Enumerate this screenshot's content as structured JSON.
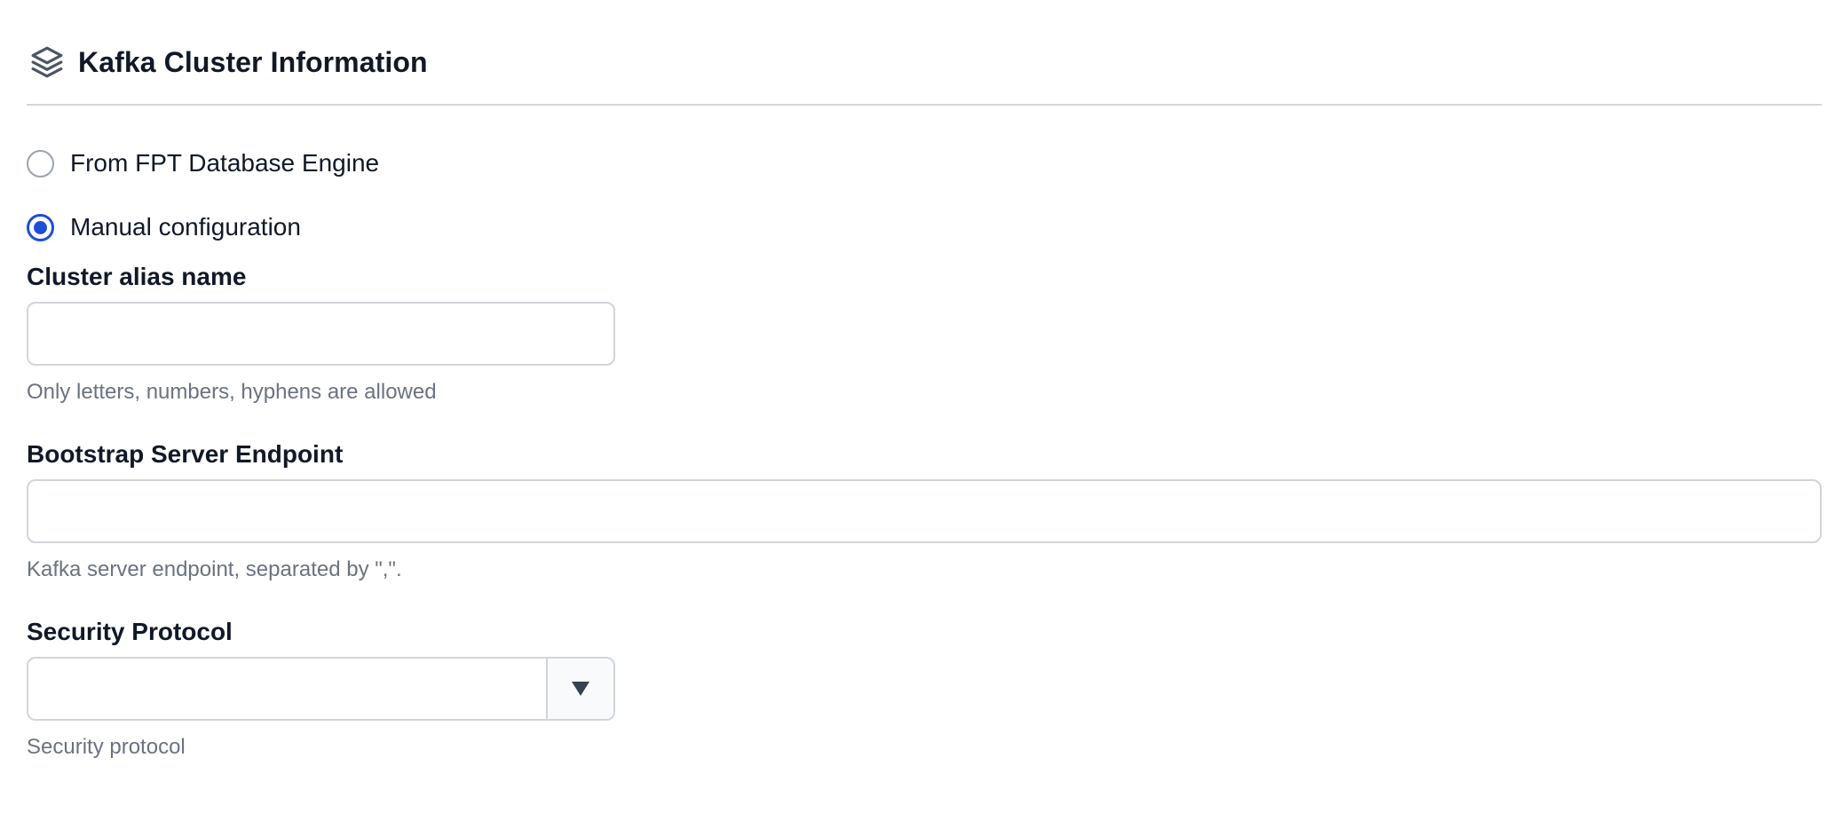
{
  "section": {
    "title": "Kafka Cluster Information",
    "icon": "layers-icon"
  },
  "source_options": [
    {
      "label": "From FPT Database Engine",
      "checked": false
    },
    {
      "label": "Manual configuration",
      "checked": true
    }
  ],
  "fields": {
    "cluster_alias": {
      "label": "Cluster alias name",
      "value": "",
      "placeholder": "",
      "help": "Only letters, numbers, hyphens are allowed"
    },
    "bootstrap": {
      "label": "Bootstrap Server Endpoint",
      "value": "",
      "placeholder": "",
      "help": "Kafka server endpoint, separated by \",\"."
    },
    "security_protocol": {
      "label": "Security Protocol",
      "selected": "",
      "help": "Security protocol"
    }
  },
  "colors": {
    "accent": "#1d4ed8",
    "border": "#d1d5db",
    "help_text": "#6b7280",
    "heading": "#111827"
  }
}
